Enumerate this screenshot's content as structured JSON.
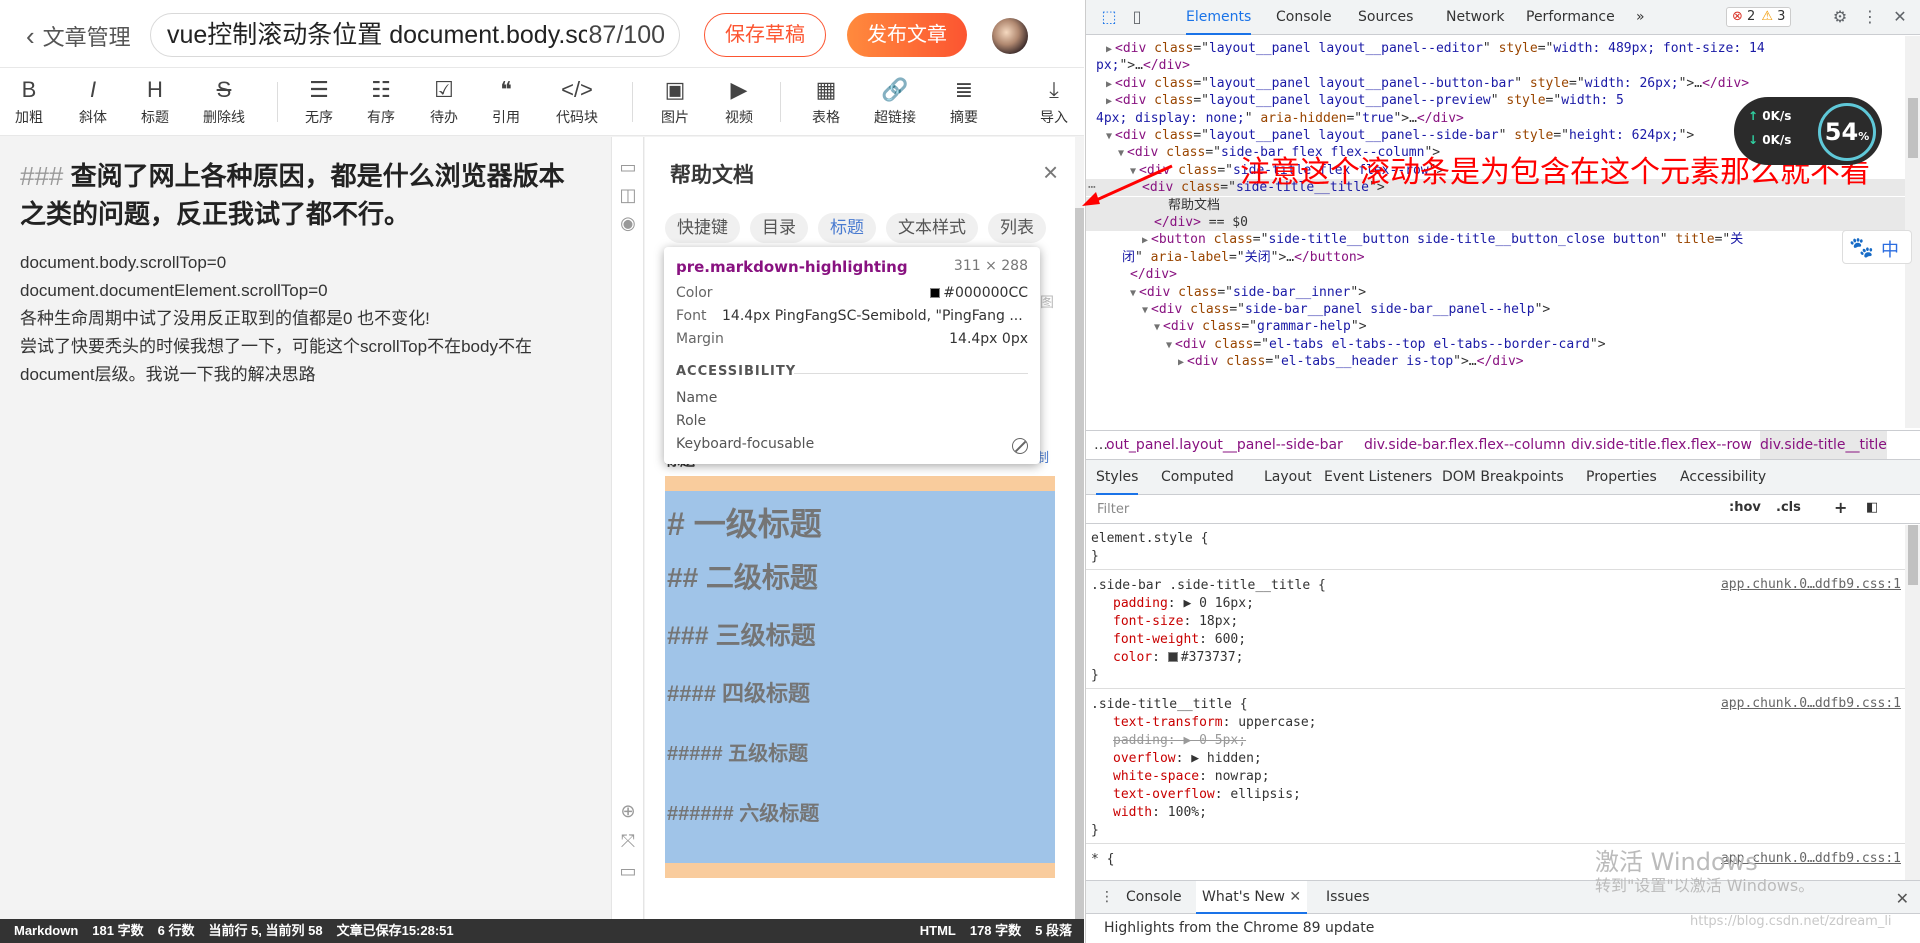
{
  "editor": {
    "back_label": "文章管理",
    "title_value": "vue控制滚动条位置 document.body.scrollTop",
    "title_count": "87/100",
    "save_draft": "保存草稿",
    "publish": "发布文章",
    "toolbar": [
      {
        "icon": "B",
        "label": "加粗",
        "icon_name": "bold-icon"
      },
      {
        "icon": "I",
        "label": "斜体",
        "icon_name": "italic-icon"
      },
      {
        "icon": "H",
        "label": "标题",
        "icon_name": "heading-icon"
      },
      {
        "icon": "S",
        "label": "删除线",
        "icon_name": "strikethrough-icon"
      },
      {
        "icon": "☰",
        "label": "无序",
        "icon_name": "unordered-list-icon"
      },
      {
        "icon": "☷",
        "label": "有序",
        "icon_name": "ordered-list-icon"
      },
      {
        "icon": "☑",
        "label": "待办",
        "icon_name": "todo-icon"
      },
      {
        "icon": "❝",
        "label": "引用",
        "icon_name": "quote-icon"
      },
      {
        "icon": "</>",
        "label": "代码块",
        "icon_name": "code-block-icon"
      },
      {
        "icon": "▣",
        "label": "图片",
        "icon_name": "image-icon"
      },
      {
        "icon": "▶",
        "label": "视频",
        "icon_name": "video-icon"
      },
      {
        "icon": "▦",
        "label": "表格",
        "icon_name": "table-icon"
      },
      {
        "icon": "🔗",
        "label": "超链接",
        "icon_name": "link-icon"
      },
      {
        "icon": "≣",
        "label": "摘要",
        "icon_name": "summary-icon"
      },
      {
        "icon": "⤓",
        "label": "导入",
        "icon_name": "import-icon"
      }
    ],
    "heading_hash": "###",
    "heading_text": "查阅了网上各种原因，都是什么浏览器版本之类的问题，反正我试了都不行。",
    "body_lines": [
      "document.body.scrollTop=0",
      "document.documentElement.scrollTop=0",
      "各种生命周期中试了没用反正取到的值都是0 也不变化!",
      "尝试了快要秃头的时候我想了一下，可能这个scrollTop不在body不在document层级。我说一下我的解决思路"
    ]
  },
  "help": {
    "title": "帮助文档",
    "tabs": [
      "快捷键",
      "目录",
      "标题",
      "文本样式",
      "列表"
    ],
    "active_tab": "标题",
    "sub_title": "标题",
    "copy": "复制",
    "headings": [
      "# 一级标题",
      "## 二级标题",
      "### 三级标题",
      "#### 四级标题",
      "##### 五级标题",
      "###### 六级标题"
    ]
  },
  "tooltip": {
    "selector": "pre.markdown-highlighting",
    "dimensions": "311 × 288",
    "color_label": "Color",
    "color_value": "#000000CC",
    "font_label": "Font",
    "font_value": "14.4px PingFangSC-Semibold, \"PingFang ...",
    "margin_label": "Margin",
    "margin_value": "14.4px 0px",
    "accessibility": "ACCESSIBILITY",
    "name_label": "Name",
    "role_label": "Role",
    "kb_label": "Keyboard-focusable"
  },
  "status": {
    "left": [
      "Markdown",
      "181 字数",
      "6 行数",
      "当前行 5, 当前列 58",
      "文章已保存15:28:51"
    ],
    "right": [
      "HTML",
      "178 字数",
      "5 段落"
    ]
  },
  "devtools": {
    "tabs": [
      "Elements",
      "Console",
      "Sources",
      "Network",
      "Performance"
    ],
    "more": "»",
    "errors": "2",
    "warnings": "3",
    "dom_lines": [
      {
        "indent": 12,
        "tri": "▶",
        "html": "<span class='tag'>&lt;div</span> <span class='an'>class</span>=\"<span class='av'>layout__panel layout__panel--editor</span>\" <span class='an'>style</span>=\"<span class='av'>width: 489px; font-size: 14</span>"
      },
      {
        "indent": 2,
        "tri": "",
        "html": "<span class='av'>px;</span>\"&gt;…<span class='tag'>&lt;/div&gt;</span>"
      },
      {
        "indent": 12,
        "tri": "▶",
        "html": "<span class='tag'>&lt;div</span> <span class='an'>class</span>=\"<span class='av'>layout__panel layout__panel--button-bar</span>\" <span class='an'>style</span>=\"<span class='av'>width: 26px;</span>\"&gt;…<span class='tag'>&lt;/div&gt;</span>"
      },
      {
        "indent": 12,
        "tri": "▶",
        "html": "<span class='tag'>&lt;div</span> <span class='an'>class</span>=\"<span class='av'>layout__panel layout__panel--preview</span>\" <span class='an'>style</span>=\"<span class='av'>width: 5</span>"
      },
      {
        "indent": 2,
        "tri": "",
        "html": "<span class='av'>4px; display: none;</span>\" <span class='an'>aria-hidden</span>=\"<span class='av'>true</span>\"&gt;…<span class='tag'>&lt;/div&gt;</span>"
      },
      {
        "indent": 12,
        "tri": "▼",
        "html": "<span class='tag'>&lt;div</span> <span class='an'>class</span>=\"<span class='av'>layout__panel layout__panel--side-bar</span>\" <span class='an'>style</span>=\"<span class='av'>height: 624px;</span>\"&gt;"
      },
      {
        "indent": 24,
        "tri": "▼",
        "html": "<span class='tag'>&lt;div</span> <span class='an'>class</span>=\"<span class='av'>side-bar flex flex--column</span>\"&gt;"
      },
      {
        "indent": 36,
        "tri": "▼",
        "html": "<span class='tag'>&lt;div</span> <span class='an'>class</span>=\"<span class='av'>side-title flex flex--row</span>\"&gt;"
      },
      {
        "indent": 48,
        "tri": "",
        "html": "<span class='tag'>&lt;div</span> <span class='an'>class</span>=\"<span class='av'>side-title__title</span>\"&gt;",
        "sel": true
      },
      {
        "indent": 74,
        "tri": "",
        "html": "帮助文档",
        "sel": true
      },
      {
        "indent": 60,
        "tri": "",
        "html": "<span class='tag'>&lt;/div&gt;</span> == $0",
        "sel": true
      },
      {
        "indent": 48,
        "tri": "▶",
        "html": "<span class='tag'>&lt;button</span> <span class='an'>class</span>=\"<span class='av'>side-title__button side-title__button_close button</span>\" <span class='an'>title</span>=\"<span class='av'>关</span>"
      },
      {
        "indent": 28,
        "tri": "",
        "html": "<span class='av'>闭</span>\" <span class='an'>aria-label</span>=\"<span class='av'>关闭</span>\"&gt;…<span class='tag'>&lt;/button&gt;</span>"
      },
      {
        "indent": 36,
        "tri": "",
        "html": "<span class='tag'>&lt;/div&gt;</span>"
      },
      {
        "indent": 36,
        "tri": "▼",
        "html": "<span class='tag'>&lt;div</span> <span class='an'>class</span>=\"<span class='av'>side-bar__inner</span>\"&gt;"
      },
      {
        "indent": 48,
        "tri": "▼",
        "html": "<span class='tag'>&lt;div</span> <span class='an'>class</span>=\"<span class='av'>side-bar__panel side-bar__panel--help</span>\"&gt;"
      },
      {
        "indent": 60,
        "tri": "▼",
        "html": "<span class='tag'>&lt;div</span> <span class='an'>class</span>=\"<span class='av'>grammar-help</span>\"&gt;"
      },
      {
        "indent": 72,
        "tri": "▼",
        "html": "<span class='tag'>&lt;div</span> <span class='an'>class</span>=\"<span class='av'>el-tabs el-tabs--top el-tabs--border-card</span>\"&gt;"
      },
      {
        "indent": 84,
        "tri": "▶",
        "html": "<span class='tag'>&lt;div</span> <span class='an'>class</span>=\"<span class='av'>el-tabs__header is-top</span>\"&gt;…<span class='tag'>&lt;/div&gt;</span>"
      }
    ],
    "breadcrumbs": [
      "…",
      "out_panel.layout__panel--side-bar",
      "div.side-bar.flex.flex--column",
      "div.side-title.flex.flex--row",
      "div.side-title__title"
    ],
    "style_tabs": [
      "Styles",
      "Computed",
      "Layout",
      "Event Listeners",
      "DOM Breakpoints",
      "Properties",
      "Accessibility"
    ],
    "filter_placeholder": "Filter",
    "hov": ":hov",
    "cls": ".cls",
    "plus": "+",
    "source": "app.chunk.0…ddfb9.css:1",
    "drawer_tabs": [
      "Console",
      "What's New",
      "Issues"
    ],
    "drawer_text": "Highlights from the Chrome 89 update"
  },
  "overlay": {
    "annotation": "注意这个滚动条是为包含在这个元素那么就不看",
    "watermark_title": "激活 Windows",
    "watermark_sub": "转到\"设置\"以激活 Windows。",
    "watermark_url": "https://blog.csdn.net/zdream_li",
    "speed_up": "0K/s",
    "speed_down": "0K/s",
    "speed_pct": "54",
    "ime": "中"
  }
}
